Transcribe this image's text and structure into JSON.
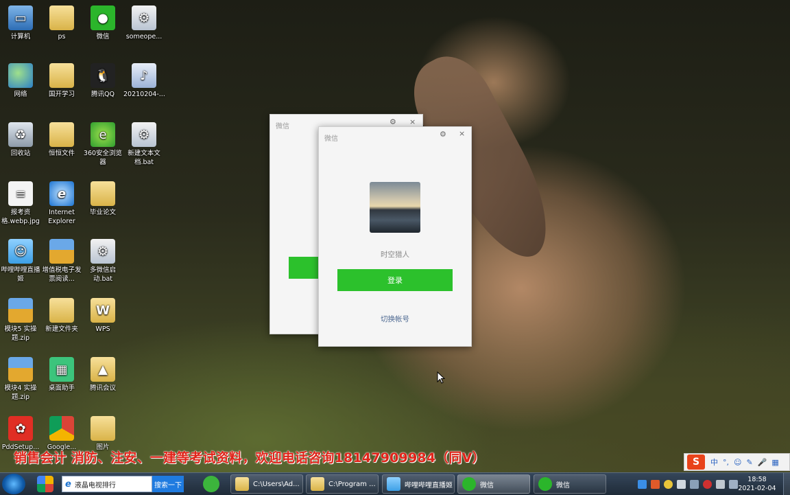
{
  "desktop": {
    "icons": [
      {
        "label": "计算机",
        "icon": "computer-icon"
      },
      {
        "label": "ps",
        "icon": "folder-icon"
      },
      {
        "label": "微信",
        "icon": "wechat-icon"
      },
      {
        "label": "someope...",
        "icon": "bat-file-icon"
      },
      {
        "label": "网络",
        "icon": "network-icon"
      },
      {
        "label": "国开学习",
        "icon": "folder-icon"
      },
      {
        "label": "腾讯QQ",
        "icon": "qq-icon"
      },
      {
        "label": "20210204-...",
        "icon": "media-file-icon"
      },
      {
        "label": "回收站",
        "icon": "recycle-bin-icon"
      },
      {
        "label": "恒恒文件",
        "icon": "folder-icon"
      },
      {
        "label": "360安全浏览器",
        "icon": "360-browser-icon"
      },
      {
        "label": "新建文本文档.bat",
        "icon": "bat-file-icon"
      },
      {
        "label": "报考资格.webp.jpg",
        "icon": "image-file-icon"
      },
      {
        "label": "Internet Explorer",
        "icon": "ie-icon"
      },
      {
        "label": "毕业论文",
        "icon": "folder-icon"
      },
      {
        "label": "哔哩哔哩直播姬",
        "icon": "bilibili-live-icon"
      },
      {
        "label": "增值税电子发票阅读...",
        "icon": "archive-icon"
      },
      {
        "label": "多微信启动.bat",
        "icon": "bat-file-icon"
      },
      {
        "label": "模块5 实操题.zip",
        "icon": "zip-icon"
      },
      {
        "label": "新建文件夹",
        "icon": "folder-icon"
      },
      {
        "label": "WPS",
        "icon": "wps-folder-icon"
      },
      {
        "label": "模块4 实操题.zip",
        "icon": "zip-icon"
      },
      {
        "label": "桌面助手",
        "icon": "desktop-helper-icon"
      },
      {
        "label": "腾讯会议",
        "icon": "tencent-meeting-icon"
      },
      {
        "label": "PddSetup...",
        "icon": "pdd-icon"
      },
      {
        "label": "Google...",
        "icon": "chrome-icon"
      },
      {
        "label": "图片",
        "icon": "folder-icon"
      }
    ]
  },
  "wechat_back": {
    "title": "微信",
    "gear": "⚙",
    "close": "×"
  },
  "wechat_front": {
    "title": "微信",
    "gear": "⚙",
    "close": "×",
    "username": "时空猎人",
    "login_label": "登录",
    "switch_label": "切换帐号"
  },
  "banner": {
    "text": "销售会计 消防、注安、一建等考试资料，欢迎电话咨询18147909984（同V）",
    "color": "#e0241a"
  },
  "ime": {
    "logo": "S",
    "items": [
      "中",
      "°,",
      "☺",
      "✎",
      "🎤",
      "▦"
    ]
  },
  "taskbar": {
    "address_value": "液晶电视排行",
    "search_label": "搜索一下",
    "tasks": [
      {
        "label": "C:\\Users\\Ad...",
        "icon": "folder-icon"
      },
      {
        "label": "C:\\Program ...",
        "icon": "folder-icon"
      },
      {
        "label": "哔哩哔哩直播姬",
        "icon": "bilibili-live-icon"
      },
      {
        "label": "微信",
        "icon": "wechat-icon"
      },
      {
        "label": "微信",
        "icon": "wechat-icon"
      }
    ],
    "time": "18:58",
    "date": "2021-02-04"
  }
}
